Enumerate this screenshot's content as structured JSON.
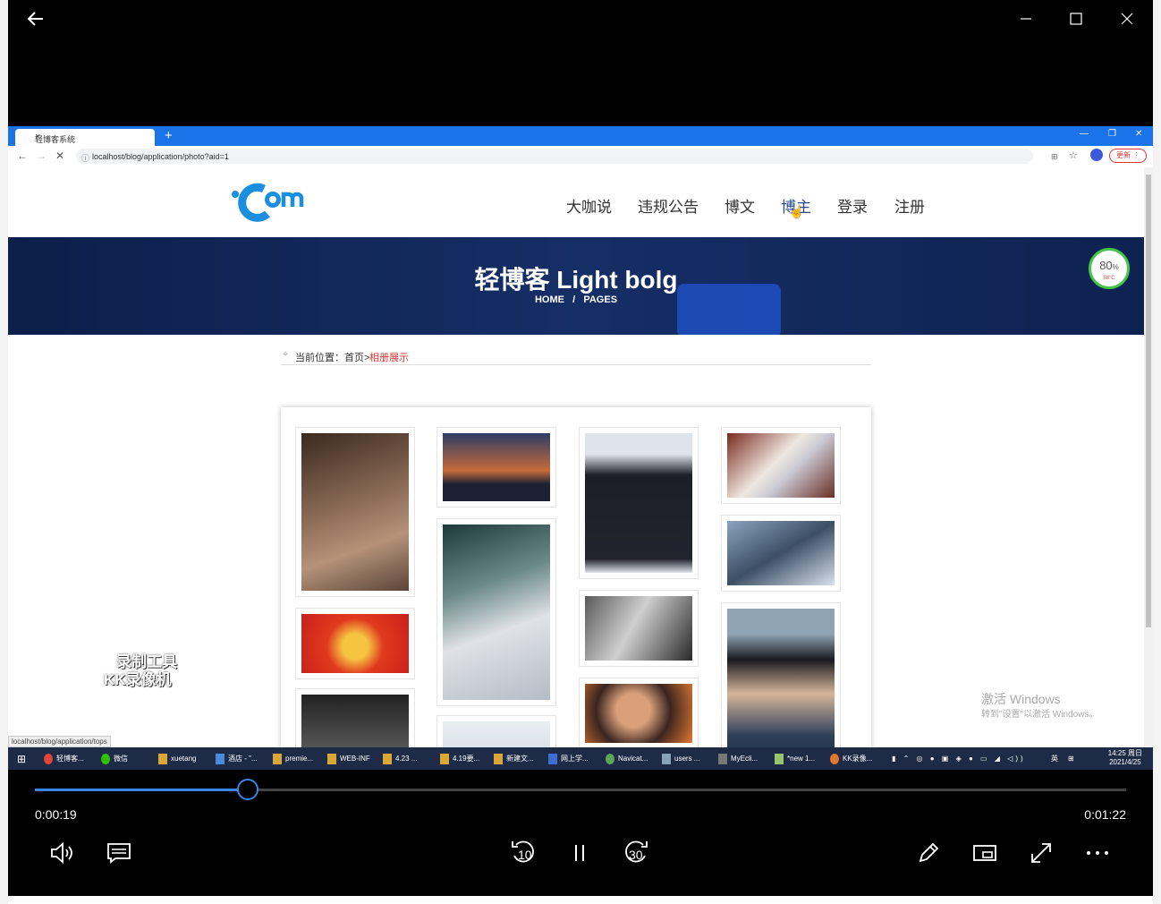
{
  "player": {
    "elapsed": "0:00:19",
    "total": "0:01:22",
    "progress_fraction": 0.195,
    "skip_back": "10",
    "skip_forward": "30"
  },
  "browser": {
    "tab_title": "轻博客系统",
    "url": "localhost/blog/application/photo?aid=1",
    "update_button": "更新",
    "status_url": "localhost/blog/application/tops"
  },
  "site": {
    "menu": [
      "大咖说",
      "违规公告",
      "博文",
      "博主",
      "登录",
      "注册"
    ],
    "banner_title": "轻博客 Light bolg",
    "crumb_home": "HOME",
    "crumb_sep": "/",
    "crumb_pages": "PAGES",
    "cpu_percent": "80",
    "cpu_unit": "%",
    "cpu_temp": "58°C",
    "position_label": "当前位置：首页>",
    "position_current": "相册展示"
  },
  "overlay": {
    "recorder_line1": "录制工具",
    "recorder_line2": "KK录像机",
    "activate_title": "激活 Windows",
    "activate_sub": "转到\"设置\"以激活 Windows。"
  },
  "taskbar": {
    "items": [
      "轻博客...",
      "微信",
      "xuetang",
      "酒店 - \"...",
      "premie...",
      "WEB-INF",
      "4.23 ...",
      "4.19要...",
      "新建文...",
      "网上学...",
      "Navicat...",
      "users ...",
      "MyEcli...",
      "*new 1...",
      "KK录像..."
    ],
    "ime": "英",
    "time": "14:25 周日",
    "date": "2021/4/25"
  }
}
